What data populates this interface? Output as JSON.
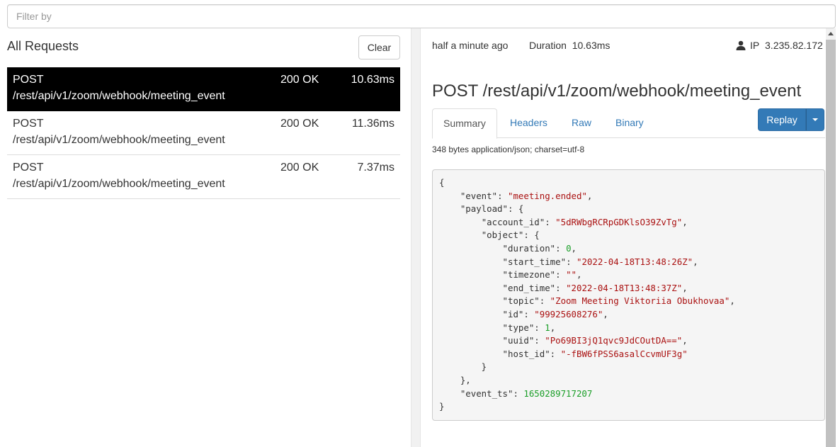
{
  "filter": {
    "placeholder": "Filter by",
    "value": ""
  },
  "left": {
    "title": "All Requests",
    "clear_label": "Clear",
    "requests": [
      {
        "method": "POST",
        "path": "/rest/api/v1/zoom/webhook/meeting_event",
        "status": "200 OK",
        "duration": "10.63ms",
        "selected": true
      },
      {
        "method": "POST",
        "path": "/rest/api/v1/zoom/webhook/meeting_event",
        "status": "200 OK",
        "duration": "11.36ms",
        "selected": false
      },
      {
        "method": "POST",
        "path": "/rest/api/v1/zoom/webhook/meeting_event",
        "status": "200 OK",
        "duration": "7.37ms",
        "selected": false
      }
    ]
  },
  "detail": {
    "time_ago": "half a minute ago",
    "duration_label": "Duration",
    "duration_value": "10.63ms",
    "ip_label": "IP",
    "ip_value": "3.235.82.172",
    "title": "POST /rest/api/v1/zoom/webhook/meeting_event",
    "tabs": [
      "Summary",
      "Headers",
      "Raw",
      "Binary"
    ],
    "active_tab": "Summary",
    "replay_label": "Replay",
    "body_meta": "348 bytes application/json; charset=utf-8",
    "json": {
      "event": "meeting.ended",
      "account_id": "5dRWbgRCRpGDKlsO39ZvTg",
      "duration": "0",
      "start_time": "2022-04-18T13:48:26Z",
      "timezone": "",
      "end_time": "2022-04-18T13:48:37Z",
      "topic": "Zoom Meeting Viktoriia Obukhovaa",
      "id": "99925608276",
      "type": "1",
      "uuid": "Po69BI3jQ1qvc9JdCOutDA==",
      "host_id": "-fBW6fPSS6asalCcvmUF3g",
      "event_ts": "1650289717207"
    }
  },
  "colors": {
    "accent": "#337ab7",
    "selected_row": "#000000",
    "json_string": "#aa1111",
    "json_number": "#1a9e27"
  },
  "icons": {
    "user": "user-icon",
    "caret": "caret-down-icon"
  }
}
